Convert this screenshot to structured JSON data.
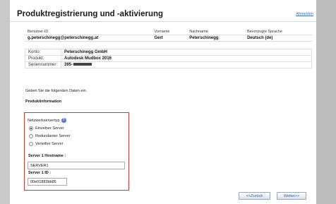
{
  "title": "Produktregistrierung und -aktivierung",
  "logout_link": "Abmelden",
  "user_table": {
    "headers": [
      "Benutzer-ID",
      "Vorname",
      "Nachname",
      "Bevorzugte Sprache"
    ],
    "values": [
      "g.peterschinegg@peterschinegg.at",
      "Gert",
      "Peterschinegg",
      "Deutsch (de)"
    ]
  },
  "info_table": {
    "rows": [
      {
        "label": "Konto:",
        "value": "Peterschinegg GmbH"
      },
      {
        "label": "Produkt:",
        "value": "Autodesk Mudbox 2016"
      },
      {
        "label": "Seriennummer:",
        "value": "395-"
      }
    ]
  },
  "instruction": "Geben Sie die folgenden Daten ein.",
  "section_heading": "Produktinformation",
  "network": {
    "type_label": "Netzwerkservertyp",
    "help_icon": "?",
    "options": [
      "Einzelner Server",
      "Redundanter Server",
      "Verteilter Server"
    ],
    "selected": "Einzelner Server",
    "hostname_label": "Server 1 Hostname :",
    "hostname_value": "SERVER1",
    "id_label": "Server 1 ID :",
    "id_value": "00e01883bb85"
  },
  "buttons": {
    "back": "<<Zurück",
    "next": "Weiter>>"
  },
  "colors": {
    "highlight_border": "#d9362c",
    "link": "#3a6fc4"
  }
}
